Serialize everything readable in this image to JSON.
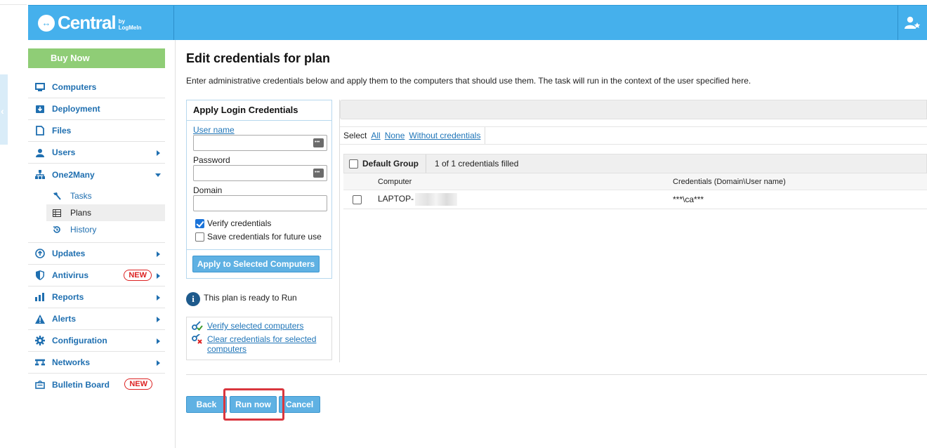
{
  "header": {
    "logo_text": "Central",
    "logo_by_line1": "by",
    "logo_by_line2": "LogMeIn"
  },
  "sidebar": {
    "buy_now": "Buy Now",
    "items": [
      {
        "label": "Computers",
        "icon": "monitor-icon"
      },
      {
        "label": "Deployment",
        "icon": "download-icon"
      },
      {
        "label": "Files",
        "icon": "file-icon"
      },
      {
        "label": "Users",
        "icon": "user-icon"
      },
      {
        "label": "One2Many",
        "icon": "hierarchy-icon"
      },
      {
        "label": "Updates",
        "icon": "arrow-up-circle-icon"
      },
      {
        "label": "Antivirus",
        "icon": "shield-icon",
        "badge": "NEW"
      },
      {
        "label": "Reports",
        "icon": "bar-chart-icon"
      },
      {
        "label": "Alerts",
        "icon": "warning-icon"
      },
      {
        "label": "Configuration",
        "icon": "gear-icon"
      },
      {
        "label": "Networks",
        "icon": "network-icon"
      },
      {
        "label": "Bulletin Board",
        "icon": "board-icon",
        "badge": "NEW"
      }
    ],
    "one2many_sub": [
      {
        "label": "Tasks",
        "icon": "hammer-icon"
      },
      {
        "label": "Plans",
        "icon": "table-icon"
      },
      {
        "label": "History",
        "icon": "history-icon"
      }
    ]
  },
  "page": {
    "title": "Edit credentials for plan",
    "intro": "Enter administrative credentials below and apply them to the computers that should use them. The task will run in the context of the user specified here."
  },
  "credentials_panel": {
    "heading": "Apply Login Credentials",
    "username_label": "User name",
    "username_value": "",
    "password_label": "Password",
    "password_value": "",
    "domain_label": "Domain",
    "domain_value": "",
    "verify_label": "Verify credentials",
    "verify_checked": true,
    "save_label": "Save credentials for future use",
    "save_checked": false,
    "apply_button": "Apply to Selected Computers"
  },
  "status": {
    "ready_text": "This plan is ready to Run"
  },
  "actions": {
    "verify_link": "Verify selected computers",
    "clear_link_line1": "Clear credentials for selected",
    "clear_link_line2": "computers"
  },
  "selection": {
    "select_label": "Select",
    "all": "All",
    "none": "None",
    "without": "Without credentials"
  },
  "grid": {
    "group_name": "Default Group",
    "group_status": "1 of 1 credentials filled",
    "columns": [
      "Computer",
      "Credentials (Domain\\User name)"
    ],
    "rows": [
      {
        "computer": "LAPTOP-",
        "credentials": "***\\ca***"
      }
    ]
  },
  "footer": {
    "back": "Back",
    "run_now": "Run now",
    "cancel": "Cancel"
  },
  "colors": {
    "header": "#45b0ec",
    "buy_now": "#8fcd76",
    "link": "#1f75b8",
    "button": "#5fb1e3",
    "highlight": "#d9363e"
  }
}
